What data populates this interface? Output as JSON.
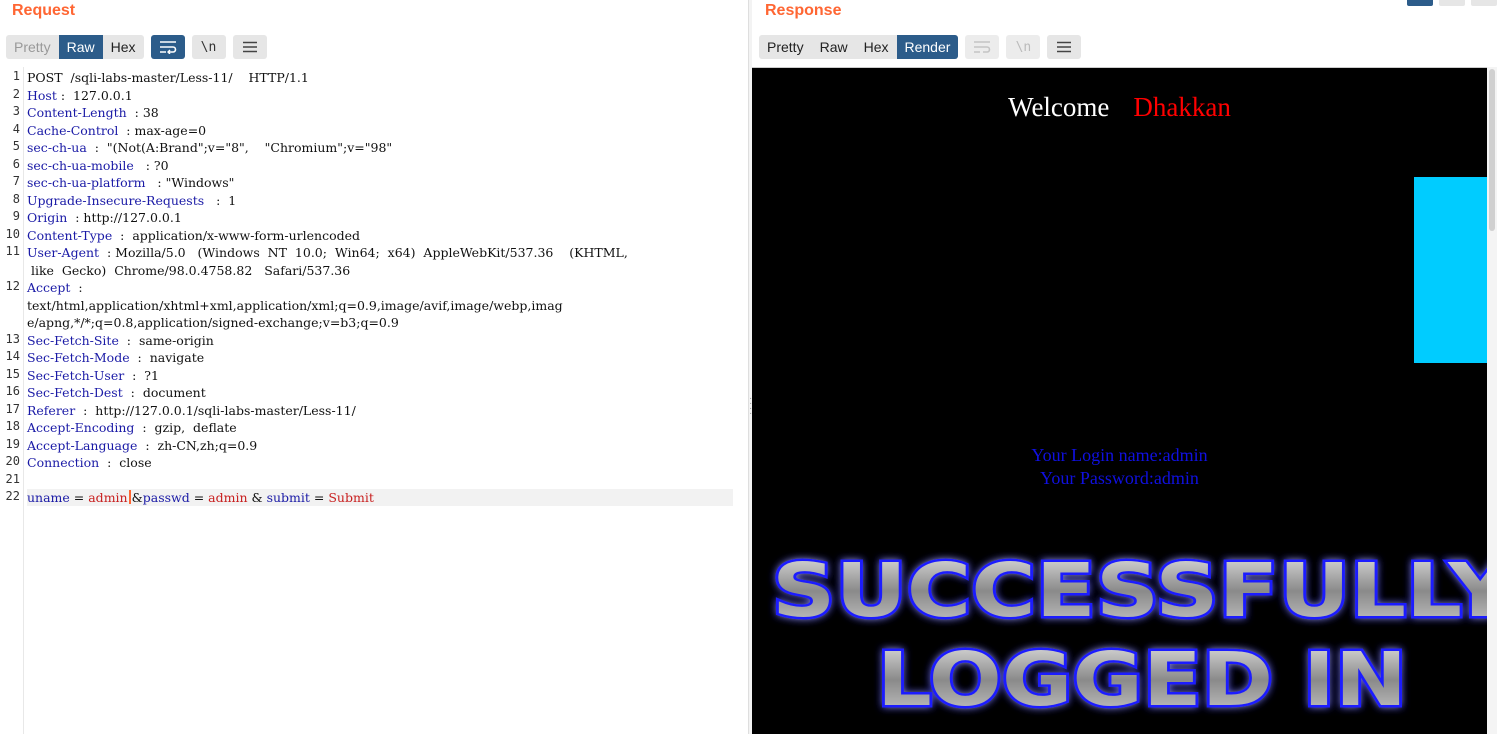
{
  "request": {
    "title": "Request",
    "tabs": [
      "Pretty",
      "Raw",
      "Hex"
    ],
    "active_tab": "Raw",
    "toolbar_icons": [
      "wrap-lines-icon",
      "newline-icon",
      "menu-icon"
    ],
    "lines": [
      {
        "n": "1",
        "segments": [
          {
            "t": "POST  /sqli-labs-master/Less-11/    HTTP/1.1",
            "c": "plain"
          }
        ]
      },
      {
        "n": "2",
        "segments": [
          {
            "t": "Host",
            "c": "hk"
          },
          {
            "t": " :  127.0.0.1",
            "c": "plain"
          }
        ]
      },
      {
        "n": "3",
        "segments": [
          {
            "t": "Content-Length",
            "c": "hk"
          },
          {
            "t": "  : 38",
            "c": "plain"
          }
        ]
      },
      {
        "n": "4",
        "segments": [
          {
            "t": "Cache-Control",
            "c": "hk"
          },
          {
            "t": "  : max-age=0",
            "c": "plain"
          }
        ]
      },
      {
        "n": "5",
        "segments": [
          {
            "t": "sec-ch-ua",
            "c": "hk"
          },
          {
            "t": "  :  \"(Not(A:Brand\";v=\"8\",    \"Chromium\";v=\"98\"",
            "c": "plain"
          }
        ]
      },
      {
        "n": "6",
        "segments": [
          {
            "t": "sec-ch-ua-mobile",
            "c": "hk"
          },
          {
            "t": "   : ?0",
            "c": "plain"
          }
        ]
      },
      {
        "n": "7",
        "segments": [
          {
            "t": "sec-ch-ua-platform",
            "c": "hk"
          },
          {
            "t": "   : \"Windows\"",
            "c": "plain"
          }
        ]
      },
      {
        "n": "8",
        "segments": [
          {
            "t": "Upgrade-Insecure-Requests",
            "c": "hk"
          },
          {
            "t": "   :  1",
            "c": "plain"
          }
        ]
      },
      {
        "n": "9",
        "segments": [
          {
            "t": "Origin",
            "c": "hk"
          },
          {
            "t": "  : http://127.0.0.1",
            "c": "plain"
          }
        ]
      },
      {
        "n": "10",
        "segments": [
          {
            "t": "Content-Type",
            "c": "hk"
          },
          {
            "t": "  :  application/x-www-form-urlencoded",
            "c": "plain"
          }
        ]
      },
      {
        "n": "11",
        "segments": [
          {
            "t": "User-Agent",
            "c": "hk"
          },
          {
            "t": "  : Mozilla/5.0   (Windows  NT  10.0;  Win64;  x64)  AppleWebKit/537.36    (KHTML,",
            "c": "plain"
          }
        ]
      },
      {
        "n": "",
        "segments": [
          {
            "t": " like  Gecko)  Chrome/98.0.4758.82   Safari/537.36",
            "c": "plain"
          }
        ]
      },
      {
        "n": "12",
        "segments": [
          {
            "t": "Accept",
            "c": "hk"
          },
          {
            "t": "  :",
            "c": "plain"
          }
        ]
      },
      {
        "n": "",
        "segments": [
          {
            "t": "text/html,application/xhtml+xml,application/xml;q=0.9,image/avif,image/webp,imag",
            "c": "plain"
          }
        ]
      },
      {
        "n": "",
        "segments": [
          {
            "t": "e/apng,*/*;q=0.8,application/signed-exchange;v=b3;q=0.9",
            "c": "plain"
          }
        ]
      },
      {
        "n": "13",
        "segments": [
          {
            "t": "Sec-Fetch-Site",
            "c": "hk"
          },
          {
            "t": "  :  same-origin",
            "c": "plain"
          }
        ]
      },
      {
        "n": "14",
        "segments": [
          {
            "t": "Sec-Fetch-Mode",
            "c": "hk"
          },
          {
            "t": "  :  navigate",
            "c": "plain"
          }
        ]
      },
      {
        "n": "15",
        "segments": [
          {
            "t": "Sec-Fetch-User",
            "c": "hk"
          },
          {
            "t": "  :  ?1",
            "c": "plain"
          }
        ]
      },
      {
        "n": "16",
        "segments": [
          {
            "t": "Sec-Fetch-Dest",
            "c": "hk"
          },
          {
            "t": "  :  document",
            "c": "plain"
          }
        ]
      },
      {
        "n": "17",
        "segments": [
          {
            "t": "Referer",
            "c": "hk"
          },
          {
            "t": "  :  http://127.0.0.1/sqli-labs-master/Less-11/",
            "c": "plain"
          }
        ]
      },
      {
        "n": "18",
        "segments": [
          {
            "t": "Accept-Encoding",
            "c": "hk"
          },
          {
            "t": "  :  gzip,  deflate",
            "c": "plain"
          }
        ]
      },
      {
        "n": "19",
        "segments": [
          {
            "t": "Accept-Language",
            "c": "hk"
          },
          {
            "t": "  :  zh-CN,zh;q=0.9",
            "c": "plain"
          }
        ]
      },
      {
        "n": "20",
        "segments": [
          {
            "t": "Connection",
            "c": "hk"
          },
          {
            "t": "  :  close",
            "c": "plain"
          }
        ]
      },
      {
        "n": "21",
        "segments": []
      },
      {
        "n": "22",
        "highlight": true,
        "segments": [
          {
            "t": "uname",
            "c": "pk"
          },
          {
            "t": " = ",
            "c": "plain"
          },
          {
            "t": "admin",
            "c": "pv"
          },
          {
            "t": "",
            "c": "caret"
          },
          {
            "t": "&",
            "c": "plain"
          },
          {
            "t": "passwd",
            "c": "pk"
          },
          {
            "t": " = ",
            "c": "plain"
          },
          {
            "t": "admin",
            "c": "pv"
          },
          {
            "t": " & ",
            "c": "plain"
          },
          {
            "t": "submit",
            "c": "pk"
          },
          {
            "t": " = ",
            "c": "plain"
          },
          {
            "t": "Submit",
            "c": "pv"
          }
        ]
      }
    ]
  },
  "response": {
    "title": "Response",
    "tabs": [
      "Pretty",
      "Raw",
      "Hex",
      "Render"
    ],
    "active_tab": "Render",
    "toolbar_icons": [
      "wrap-lines-icon",
      "newline-icon",
      "menu-icon"
    ],
    "render": {
      "welcome": "Welcome",
      "name": "Dhakkan",
      "login_name": "Your Login name:admin",
      "password": "Your Password:admin",
      "banner_line1": "SUCCESSFULLY",
      "banner_line2": "LOGGED IN"
    }
  },
  "colors": {
    "title": "#ff6633",
    "active_tab": "#2c5c8a",
    "header_key": "#1a1aa6",
    "param_value": "#c81e1e",
    "render_bg": "#000000",
    "cyan_block": "#00ccff",
    "login_text": "#1010e0"
  }
}
